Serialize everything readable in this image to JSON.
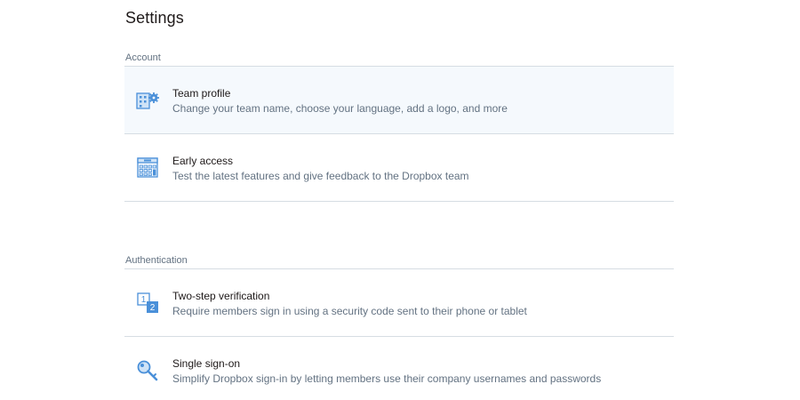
{
  "page": {
    "title": "Settings"
  },
  "sections": [
    {
      "label": "Account",
      "items": [
        {
          "title": "Team profile",
          "description": "Change your team name, choose your language, add a logo, and more",
          "icon": "team-profile-icon"
        },
        {
          "title": "Early access",
          "description": "Test the latest features and give feedback to the Dropbox team",
          "icon": "calendar-icon"
        }
      ]
    },
    {
      "label": "Authentication",
      "items": [
        {
          "title": "Two-step verification",
          "description": "Require members sign in using a security code sent to their phone or tablet",
          "icon": "two-step-icon",
          "icon_text": [
            "1",
            "2"
          ]
        },
        {
          "title": "Single sign-on",
          "description": "Simplify Dropbox sign-in by letting members use their company usernames and passwords",
          "icon": "key-icon"
        }
      ]
    }
  ],
  "colors": {
    "icon_blue": "#4a90d9",
    "icon_light": "#cfe3f7",
    "divider": "#d6dde3",
    "highlight_bg": "#f5f9fd"
  }
}
